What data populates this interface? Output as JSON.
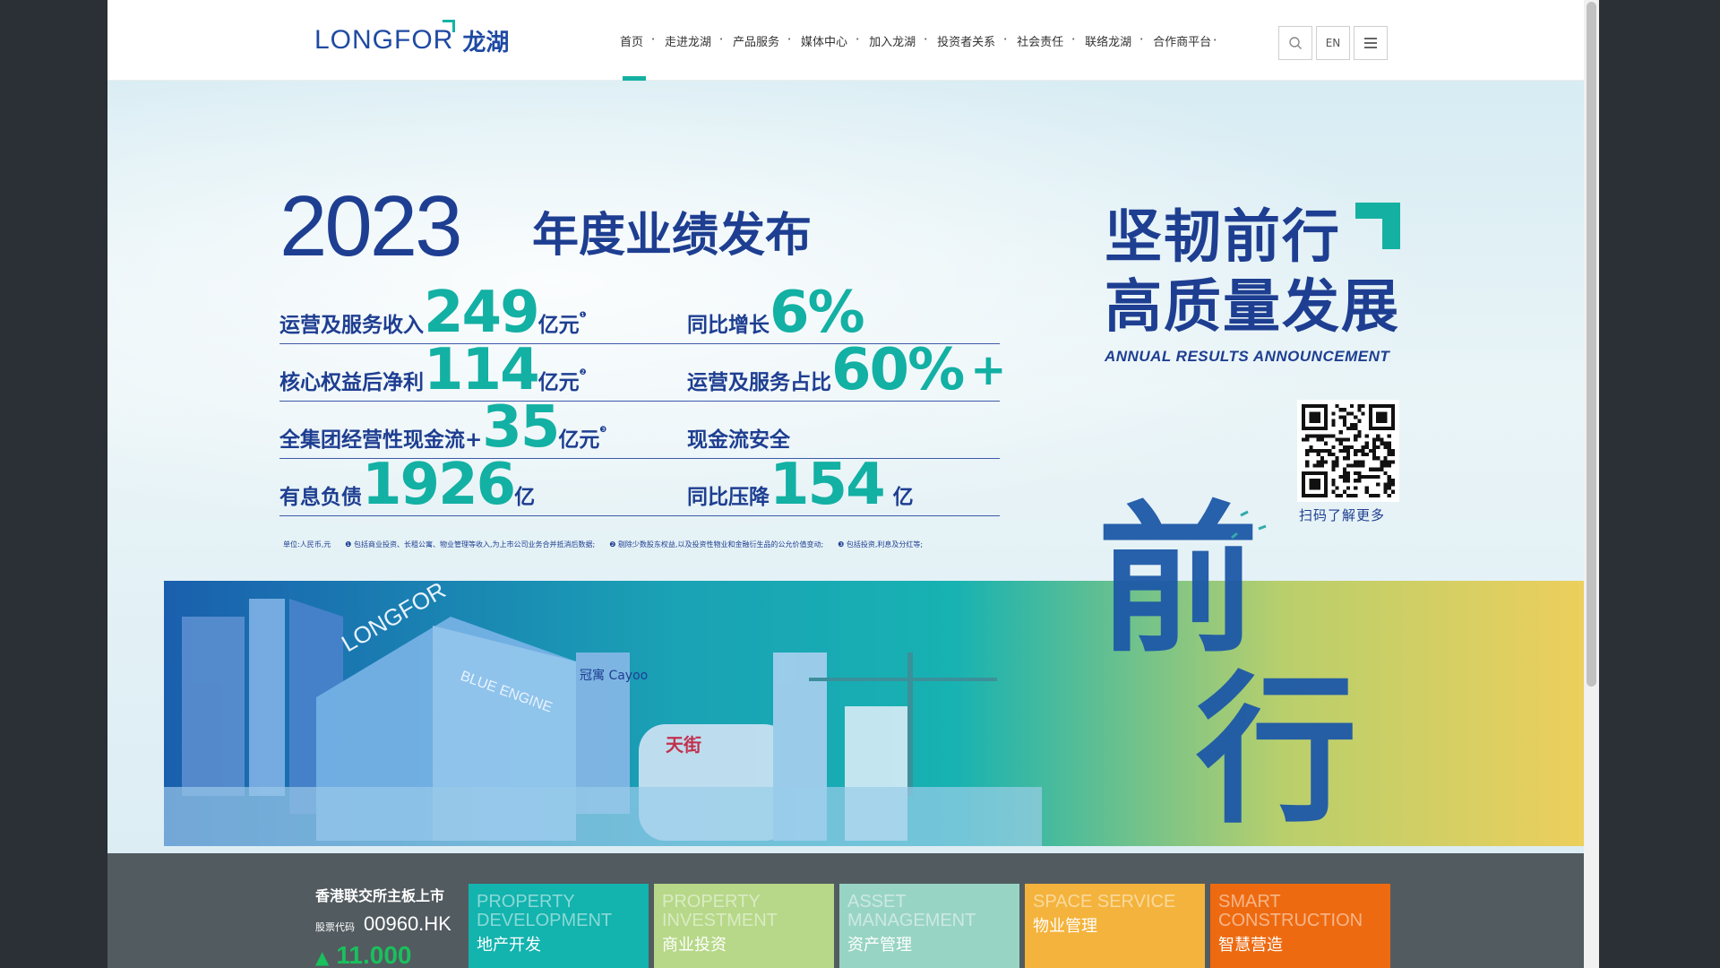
{
  "header": {
    "logo_text": "LONGFOR",
    "logo_cn": "龙湖",
    "nav": [
      {
        "label": "首页",
        "active": true
      },
      {
        "label": "走进龙湖"
      },
      {
        "label": "产品服务"
      },
      {
        "label": "媒体中心"
      },
      {
        "label": "加入龙湖"
      },
      {
        "label": "投资者关系"
      },
      {
        "label": "社会责任"
      },
      {
        "label": "联络龙湖"
      },
      {
        "label": "合作商平台"
      }
    ],
    "search_icon": "search-icon",
    "lang_label": "EN",
    "menu_icon": "hamburger-menu-icon"
  },
  "banner": {
    "year": "2023",
    "title": "年度业绩发布",
    "metrics": [
      {
        "label": "运营及服务收入",
        "value": "249",
        "unit": "亿元",
        "mark": "❶"
      },
      {
        "label": "同比增长",
        "value": "6%",
        "unit": "",
        "mark": ""
      },
      {
        "label": "核心权益后净利",
        "value": "114",
        "unit": "亿元",
        "mark": "❷"
      },
      {
        "label": "运营及服务占比",
        "value": "60%",
        "unit": "+",
        "mark": ""
      },
      {
        "label": "全集团经营性现金流+",
        "value": "35",
        "unit": "亿元",
        "mark": "❸"
      },
      {
        "label": "现金流安全",
        "value": "",
        "unit": "",
        "mark": ""
      },
      {
        "label": "有息负债",
        "value": "1926",
        "unit": "亿",
        "mark": ""
      },
      {
        "label": "同比压降",
        "value": "154",
        "unit": "亿",
        "mark": ""
      }
    ],
    "footnotes": [
      "单位:人民币,元",
      "❶ 包括商业投资、长租公寓、物业管理等收入,为上市公司业务合并抵消后数据;",
      "❷ 剔除少数股东权益,以及投资性物业和金融衍生品的公允价值变动;",
      "❸ 包括投资,利息及分红等;"
    ],
    "slogan_line1": "坚韧前行",
    "slogan_line2": "高质量发展",
    "slogan_en": "ANNUAL RESULTS ANNOUNCEMENT",
    "qr_label": "扫码了解更多",
    "calligraphy": "前行",
    "art_sign_1": "LONGFOR",
    "art_sign_2": "BLUE ENGINE",
    "art_sign_3": "冠寓 Cayoo",
    "art_sign_4": "天街"
  },
  "strip": {
    "listing": "香港联交所主板上市",
    "code_label": "股票代码",
    "code": "00960.HK",
    "price": "11.000",
    "price_color": "#19c05c",
    "tiles": [
      {
        "en": "PROPERTY DEVELOPMENT",
        "cn": "地产开发",
        "color": "#13b3ae"
      },
      {
        "en": "PROPERTY INVESTMENT",
        "cn": "商业投资",
        "color": "#b6d888"
      },
      {
        "en": "ASSET MANAGEMENT",
        "cn": "资产管理",
        "color": "#98d4c4"
      },
      {
        "en": "SPACE SERVICE",
        "cn": "物业管理",
        "color": "#f4b33c"
      },
      {
        "en": "SMART CONSTRUCTION",
        "cn": "智慧营造",
        "color": "#ee6a10"
      }
    ]
  }
}
